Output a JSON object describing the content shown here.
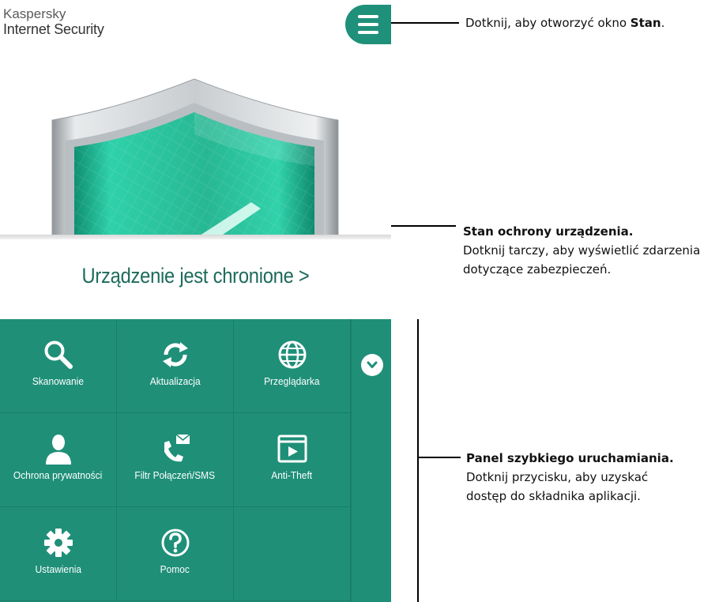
{
  "app": {
    "brand_line1": "Kaspersky",
    "brand_line2": "Internet Security",
    "status": "Urządzenie jest chronione >",
    "tiles": [
      {
        "label": "Skanowanie",
        "icon": "search-icon"
      },
      {
        "label": "Aktualizacja",
        "icon": "refresh-icon"
      },
      {
        "label": "Przeglądarka",
        "icon": "globe-icon"
      },
      {
        "label": "Ochrona prywatności",
        "icon": "person-icon"
      },
      {
        "label": "Filtr Połączeń/SMS",
        "icon": "phone-message-icon"
      },
      {
        "label": "Anti-Theft",
        "icon": "video-window-icon"
      },
      {
        "label": "Ustawienia",
        "icon": "gear-icon"
      },
      {
        "label": "Pomoc",
        "icon": "help-icon"
      }
    ]
  },
  "callouts": {
    "menu": {
      "prefix": "Dotknij, aby otworzyć okno ",
      "bold": "Stan",
      "suffix": "."
    },
    "status": {
      "title": "Stan ochrony urządzenia.",
      "line1": "Dotknij tarczy, aby wyświetlić zdarzenia",
      "line2": "dotyczące zabezpieczeń."
    },
    "panel": {
      "title": "Panel szybkiego uruchamiania.",
      "line1": "Dotknij przycisku, aby uzyskać",
      "line2": "dostęp do składnika aplikacji."
    }
  },
  "colors": {
    "accent": "#1f8f78",
    "status_text": "#1c6b5b",
    "shield_green": "#2fcca5"
  }
}
